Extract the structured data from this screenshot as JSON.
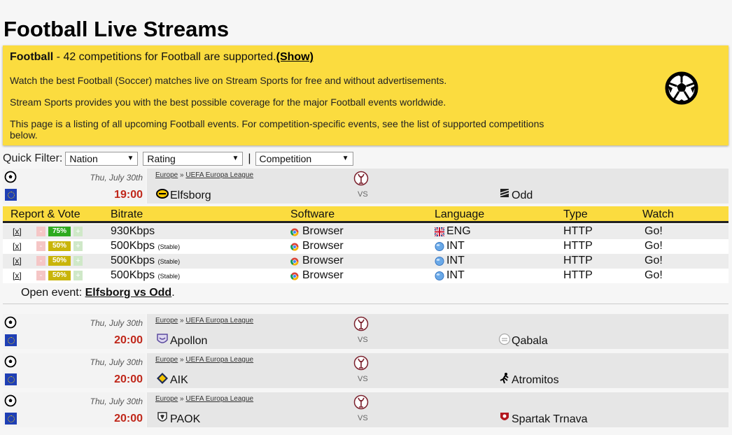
{
  "page": {
    "title": "Football Live Streams"
  },
  "intro": {
    "sport": "Football",
    "summary": " - 42 competitions for Football are supported.",
    "show_link": "(Show)",
    "p1": "Watch the best Football (Soccer) matches live on Stream Sports for free and without advertisements.",
    "p2": "Stream Sports provides you with the best possible coverage for the major Football events worldwide.",
    "p3": "This page is a listing of all upcoming Football events. For competition-specific events, see the list of supported competitions below.",
    "icon": "soccer-ball-icon",
    "background": "#fbdc3f"
  },
  "quick_filter": {
    "label": "Quick Filter:",
    "nation": "Nation",
    "rating": "Rating",
    "separator": "|",
    "competition": "Competition"
  },
  "matches": [
    {
      "date": "Thu, July 30th",
      "time": "19:00",
      "region": "Europe",
      "sep": " » ",
      "competition": "UEFA Europa League",
      "home": "Elfsborg",
      "vs": "VS",
      "away": "Odd"
    },
    {
      "date": "Thu, July 30th",
      "time": "20:00",
      "region": "Europe",
      "sep": " » ",
      "competition": "UEFA Europa League",
      "home": "Apollon",
      "vs": "VS",
      "away": "Qabala"
    },
    {
      "date": "Thu, July 30th",
      "time": "20:00",
      "region": "Europe",
      "sep": " » ",
      "competition": "UEFA Europa League",
      "home": "AIK",
      "vs": "VS",
      "away": "Atromitos"
    },
    {
      "date": "Thu, July 30th",
      "time": "20:00",
      "region": "Europe",
      "sep": " » ",
      "competition": "UEFA Europa League",
      "home": "PAOK",
      "vs": "VS",
      "away": "Spartak Trnava"
    }
  ],
  "streams": {
    "headers": {
      "report": "Report & Vote",
      "bitrate": "Bitrate",
      "software": "Software",
      "language": "Language",
      "type": "Type",
      "watch": "Watch"
    },
    "rows": [
      {
        "report": "[x]",
        "minus": "-",
        "rating": "75%",
        "rating_color": "#2eaa1f",
        "plus": "+",
        "bitrate": "930Kbps",
        "note": "",
        "software": "Browser",
        "language": "ENG",
        "lang_icon": "uk-flag-icon",
        "type": "HTTP",
        "watch": "Go!"
      },
      {
        "report": "[x]",
        "minus": "-",
        "rating": "50%",
        "rating_color": "#c9b50a",
        "plus": "+",
        "bitrate": "500Kbps",
        "note": "(Stable)",
        "software": "Browser",
        "language": "INT",
        "lang_icon": "globe-icon",
        "type": "HTTP",
        "watch": "Go!"
      },
      {
        "report": "[x]",
        "minus": "-",
        "rating": "50%",
        "rating_color": "#c9b50a",
        "plus": "+",
        "bitrate": "500Kbps",
        "note": "(Stable)",
        "software": "Browser",
        "language": "INT",
        "lang_icon": "globe-icon",
        "type": "HTTP",
        "watch": "Go!"
      },
      {
        "report": "[x]",
        "minus": "-",
        "rating": "50%",
        "rating_color": "#c9b50a",
        "plus": "+",
        "bitrate": "500Kbps",
        "note": "(Stable)",
        "software": "Browser",
        "language": "INT",
        "lang_icon": "globe-icon",
        "type": "HTTP",
        "watch": "Go!"
      }
    ],
    "open_event_label": "Open event: ",
    "open_event_link": "Elfsborg vs Odd",
    "open_event_end": "."
  },
  "colors": {
    "time": "#c0271a",
    "header": "#fbdc3f"
  }
}
